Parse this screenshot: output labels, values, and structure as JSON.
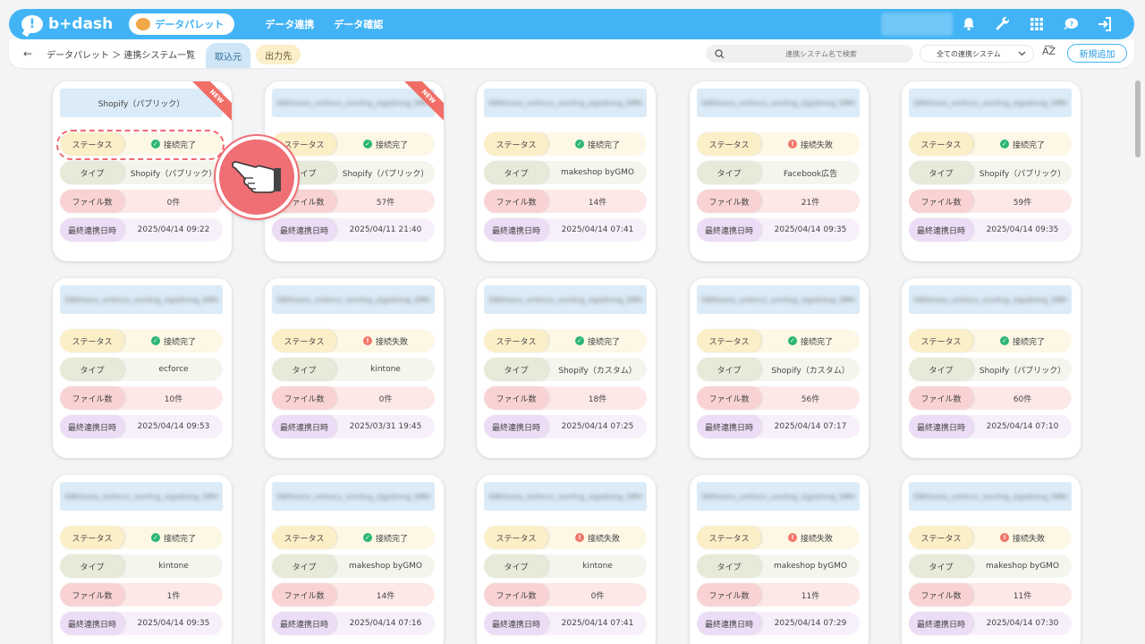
{
  "app": {
    "logo_text": "b+dash",
    "palette_label": "データパレット"
  },
  "nav": {
    "links": [
      "データ連携",
      "データ確認"
    ]
  },
  "breadcrumb": "データパレット ＞ 連携システム一覧",
  "tabs": {
    "import": "取込元",
    "export": "出力先"
  },
  "search": {
    "placeholder": "連携システム名で検索"
  },
  "filter": {
    "selected": "全ての連携システム"
  },
  "sort_label": "A͞Z",
  "add_button": "新規追加",
  "labels": {
    "status": "ステータス",
    "type": "タイプ",
    "files": "ファイル数",
    "last_sync": "最終連携日時"
  },
  "new_badge": "NEW",
  "colors": {
    "accent": "#42b4f5",
    "ok": "#2bb673",
    "ng": "#f27668"
  },
  "cards": [
    {
      "title": "Shopify（パブリック）",
      "blurred": false,
      "is_new": true,
      "status": "接続完了",
      "ok": true,
      "type": "Shopify（パブリック）",
      "files": "0件",
      "date": "2025/04/14 09:22"
    },
    {
      "title": "SWlimzns_smhncs_ssnrtng_zigzdmng_SMH",
      "blurred": true,
      "is_new": true,
      "status": "接続完了",
      "ok": true,
      "type": "Shopify（パブリック）",
      "files": "57件",
      "date": "2025/04/11 21:40"
    },
    {
      "title": "SWlimzns_smhncs_ssnrtng_zigzdmng_SMH",
      "blurred": true,
      "is_new": false,
      "status": "接続完了",
      "ok": true,
      "type": "makeshop byGMO",
      "files": "14件",
      "date": "2025/04/14 07:41"
    },
    {
      "title": "SWlimzns_smhncs_ssnrtng_zigzdmng_SMH",
      "blurred": true,
      "is_new": false,
      "status": "接続失敗",
      "ok": false,
      "type": "Facebook広告",
      "files": "21件",
      "date": "2025/04/14 09:35"
    },
    {
      "title": "SWlimzns_smhncs_ssnrtng_zigzdmng_SMH",
      "blurred": true,
      "is_new": false,
      "status": "接続完了",
      "ok": true,
      "type": "Shopify（パブリック）",
      "files": "59件",
      "date": "2025/04/14 09:35"
    },
    {
      "title": "SWlimzns_smhncs_ssnrtng_zigzdmng_SMH",
      "blurred": true,
      "is_new": false,
      "status": "接続完了",
      "ok": true,
      "type": "ecforce",
      "files": "10件",
      "date": "2025/04/14 09:53"
    },
    {
      "title": "SWlimzns_smhncs_ssnrtng_zigzdmng_SMH",
      "blurred": true,
      "is_new": false,
      "status": "接続失敗",
      "ok": false,
      "type": "kintone",
      "files": "0件",
      "date": "2025/03/31 19:45"
    },
    {
      "title": "SWlimzns_smhncs_ssnrtng_zigzdmng_SMH",
      "blurred": true,
      "is_new": false,
      "status": "接続完了",
      "ok": true,
      "type": "Shopify（カスタム）",
      "files": "18件",
      "date": "2025/04/14 07:25"
    },
    {
      "title": "SWlimzns_smhncs_ssnrtng_zigzdmng_SMH",
      "blurred": true,
      "is_new": false,
      "status": "接続完了",
      "ok": true,
      "type": "Shopify（カスタム）",
      "files": "56件",
      "date": "2025/04/14 07:17"
    },
    {
      "title": "SWlimzns_smhncs_ssnrtng_zigzdmng_SMH",
      "blurred": true,
      "is_new": false,
      "status": "接続完了",
      "ok": true,
      "type": "Shopify（パブリック）",
      "files": "60件",
      "date": "2025/04/14 07:10"
    },
    {
      "title": "SWlimzns_smhncs_ssnrtng_zigzdmng_SMH",
      "blurred": true,
      "is_new": false,
      "status": "接続完了",
      "ok": true,
      "type": "kintone",
      "files": "1件",
      "date": "2025/04/14 09:35"
    },
    {
      "title": "SWlimzns_smhncs_ssnrtng_zigzdmng_SMH",
      "blurred": true,
      "is_new": false,
      "status": "接続完了",
      "ok": true,
      "type": "makeshop byGMO",
      "files": "14件",
      "date": "2025/04/14 07:16"
    },
    {
      "title": "SWlimzns_smhncs_ssnrtng_zigzdmng_SMH",
      "blurred": true,
      "is_new": false,
      "status": "接続失敗",
      "ok": false,
      "type": "kintone",
      "files": "0件",
      "date": "2025/04/14 07:41"
    },
    {
      "title": "SWlimzns_smhncs_ssnrtng_zigzdmng_SMH",
      "blurred": true,
      "is_new": false,
      "status": "接続失敗",
      "ok": false,
      "type": "makeshop byGMO",
      "files": "11件",
      "date": "2025/04/14 07:29"
    },
    {
      "title": "SWlimzns_smhncs_ssnrtng_zigzdmng_SMH",
      "blurred": true,
      "is_new": false,
      "status": "接続失敗",
      "ok": false,
      "type": "makeshop byGMO",
      "files": "11件",
      "date": "2025/04/14 07:30"
    }
  ]
}
